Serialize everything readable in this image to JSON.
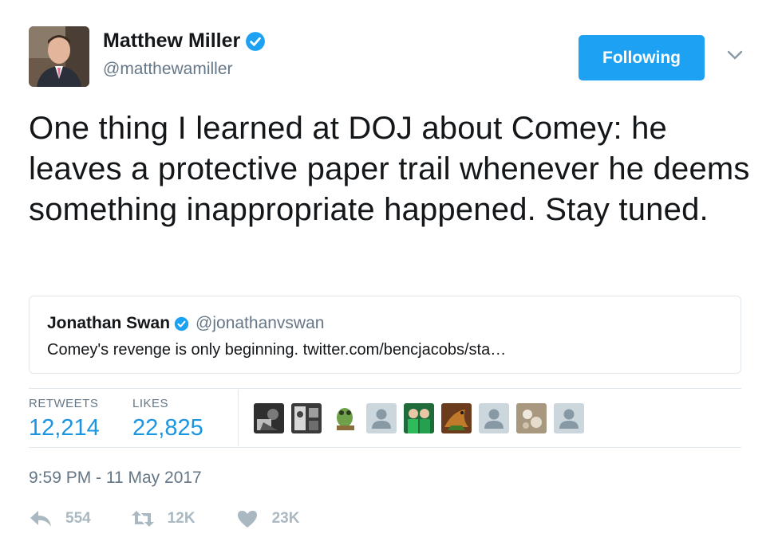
{
  "author": {
    "display_name": "Matthew Miller",
    "handle": "@matthewamiller",
    "verified": true,
    "avatar_icon": "profile-photo"
  },
  "follow_button": {
    "label": "Following",
    "color": "#1da1f2"
  },
  "menu_icon": "chevron-down-icon",
  "tweet": {
    "text": "One thing I learned at DOJ about Comey: he leaves a protective paper trail whenever he deems something inappropriate happened. Stay tuned."
  },
  "quoted_tweet": {
    "display_name": "Jonathan Swan",
    "handle": "@jonathanvswan",
    "verified": true,
    "text": "Comey's revenge is only beginning. twitter.com/bencjacobs/sta…"
  },
  "stats": {
    "retweets_label": "RETWEETS",
    "retweets_value": "12,214",
    "likes_label": "LIKES",
    "likes_value": "22,825"
  },
  "likers": [
    {
      "icon": "liker-photo-1"
    },
    {
      "icon": "liker-photo-2"
    },
    {
      "icon": "liker-photo-3"
    },
    {
      "icon": "default-avatar"
    },
    {
      "icon": "liker-photo-5"
    },
    {
      "icon": "liker-photo-6"
    },
    {
      "icon": "default-avatar"
    },
    {
      "icon": "liker-photo-8"
    },
    {
      "icon": "default-avatar"
    }
  ],
  "timestamp": "9:59 PM - 11 May 2017",
  "actions": {
    "reply_count": "554",
    "retweet_count": "12K",
    "like_count": "23K"
  },
  "colors": {
    "accent": "#1da1f2",
    "stat_value": "#1b95e0",
    "muted": "#657786",
    "action_gray": "#aab8c2"
  }
}
